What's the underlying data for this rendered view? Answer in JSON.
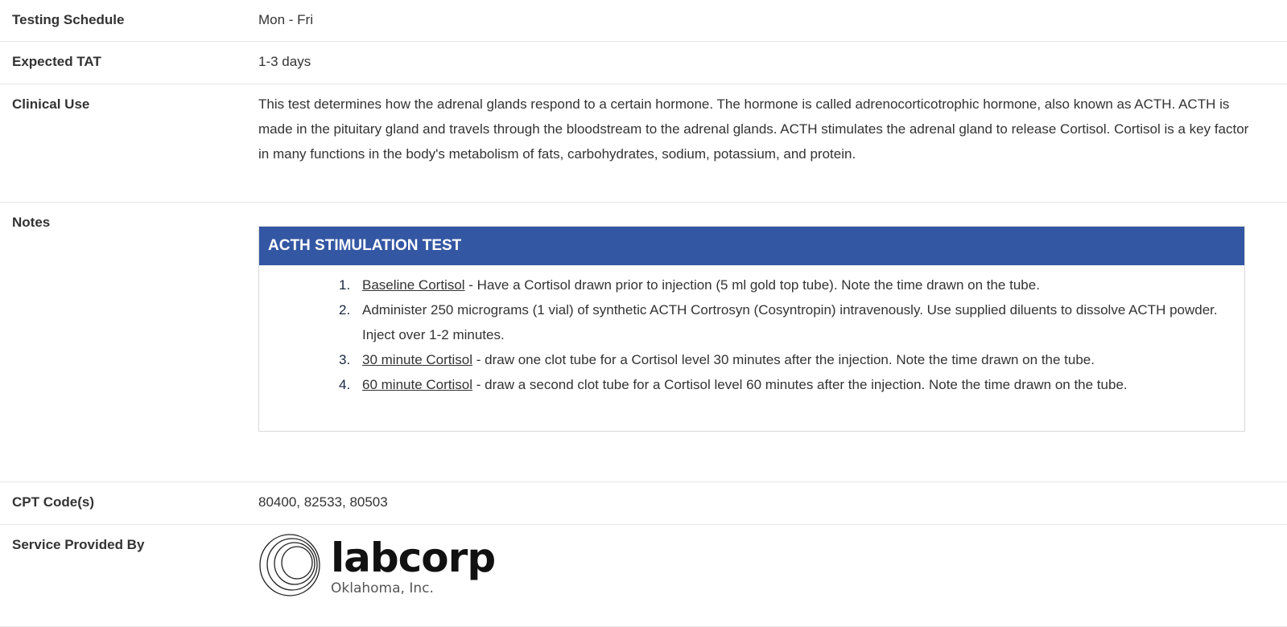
{
  "rows": {
    "testing_schedule": {
      "label": "Testing Schedule",
      "value": "Mon - Fri"
    },
    "expected_tat": {
      "label": "Expected TAT",
      "value": "1-3 days"
    },
    "clinical_use": {
      "label": "Clinical Use",
      "value": "This test determines how the adrenal glands respond to a certain hormone. The hormone is called adrenocorticotrophic hormone, also known as ACTH. ACTH is made in the pituitary gland and travels through the bloodstream to the adrenal glands. ACTH stimulates the adrenal gland to release Cortisol. Cortisol is a key factor in many functions in the body's metabolism of fats, carbohydrates, sodium, potassium, and protein."
    },
    "notes": {
      "label": "Notes",
      "panel_title": "ACTH STIMULATION TEST",
      "steps": [
        {
          "num": "1.",
          "link": "Baseline Cortisol",
          "text": " - Have a Cortisol drawn prior to injection (5 ml gold top tube). Note the time drawn on the tube."
        },
        {
          "num": "2.",
          "link": "",
          "text": "Administer 250 micrograms (1 vial) of synthetic ACTH Cortrosyn (Cosyntropin) intravenously. Use supplied diluents to dissolve ACTH powder. Inject over 1-2 minutes."
        },
        {
          "num": "3.",
          "link": "30 minute Cortisol",
          "text": " - draw one clot tube for a Cortisol level 30 minutes after the injection. Note the time drawn on the tube."
        },
        {
          "num": "4.",
          "link": "60 minute Cortisol",
          "text": " - draw a second clot tube for a Cortisol level 60 minutes after the injection. Note the time drawn on the tube."
        }
      ]
    },
    "cpt_codes": {
      "label": "CPT Code(s)",
      "value": "80400, 82533, 80503"
    },
    "service_provided_by": {
      "label": "Service Provided By",
      "logo_name": "labcorp",
      "logo_sub": "Oklahoma, Inc."
    }
  },
  "colors": {
    "panel_header": "#3457a3",
    "text": "#333333",
    "divider": "#e6e6e6"
  },
  "icons": {
    "logo_mark": "labcorp-rings-logo-icon"
  }
}
